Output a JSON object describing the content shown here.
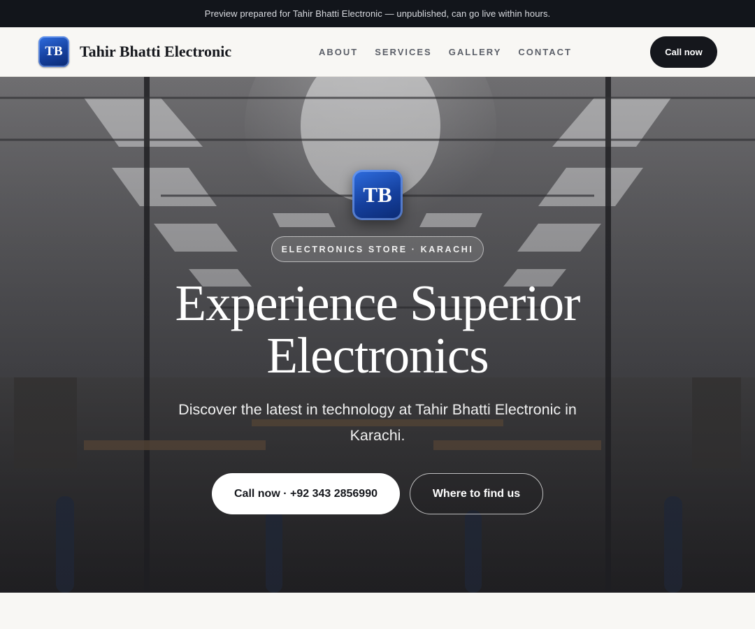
{
  "preview_bar": {
    "text": "Preview prepared for Tahir Bhatti Electronic — unpublished, can go live within hours."
  },
  "header": {
    "logo_text": "TB",
    "brand_name": "Tahir Bhatti Electronic",
    "nav": [
      {
        "label": "ABOUT"
      },
      {
        "label": "SERVICES"
      },
      {
        "label": "GALLERY"
      },
      {
        "label": "CONTACT"
      }
    ],
    "cta_label": "Call now"
  },
  "hero": {
    "logo_text": "TB",
    "tag": "ELECTRONICS STORE · KARACHI",
    "headline_line1": "Experience Superior",
    "headline_line2": "Electronics",
    "subhead": "Discover the latest in technology at Tahir Bhatti Electronic in Karachi.",
    "primary_button": "Call now · +92 343 2856990",
    "secondary_button": "Where to find us"
  },
  "colors": {
    "dark": "#15171c",
    "page_background": "#f8f7f4",
    "logo_blue": "#15409e"
  }
}
